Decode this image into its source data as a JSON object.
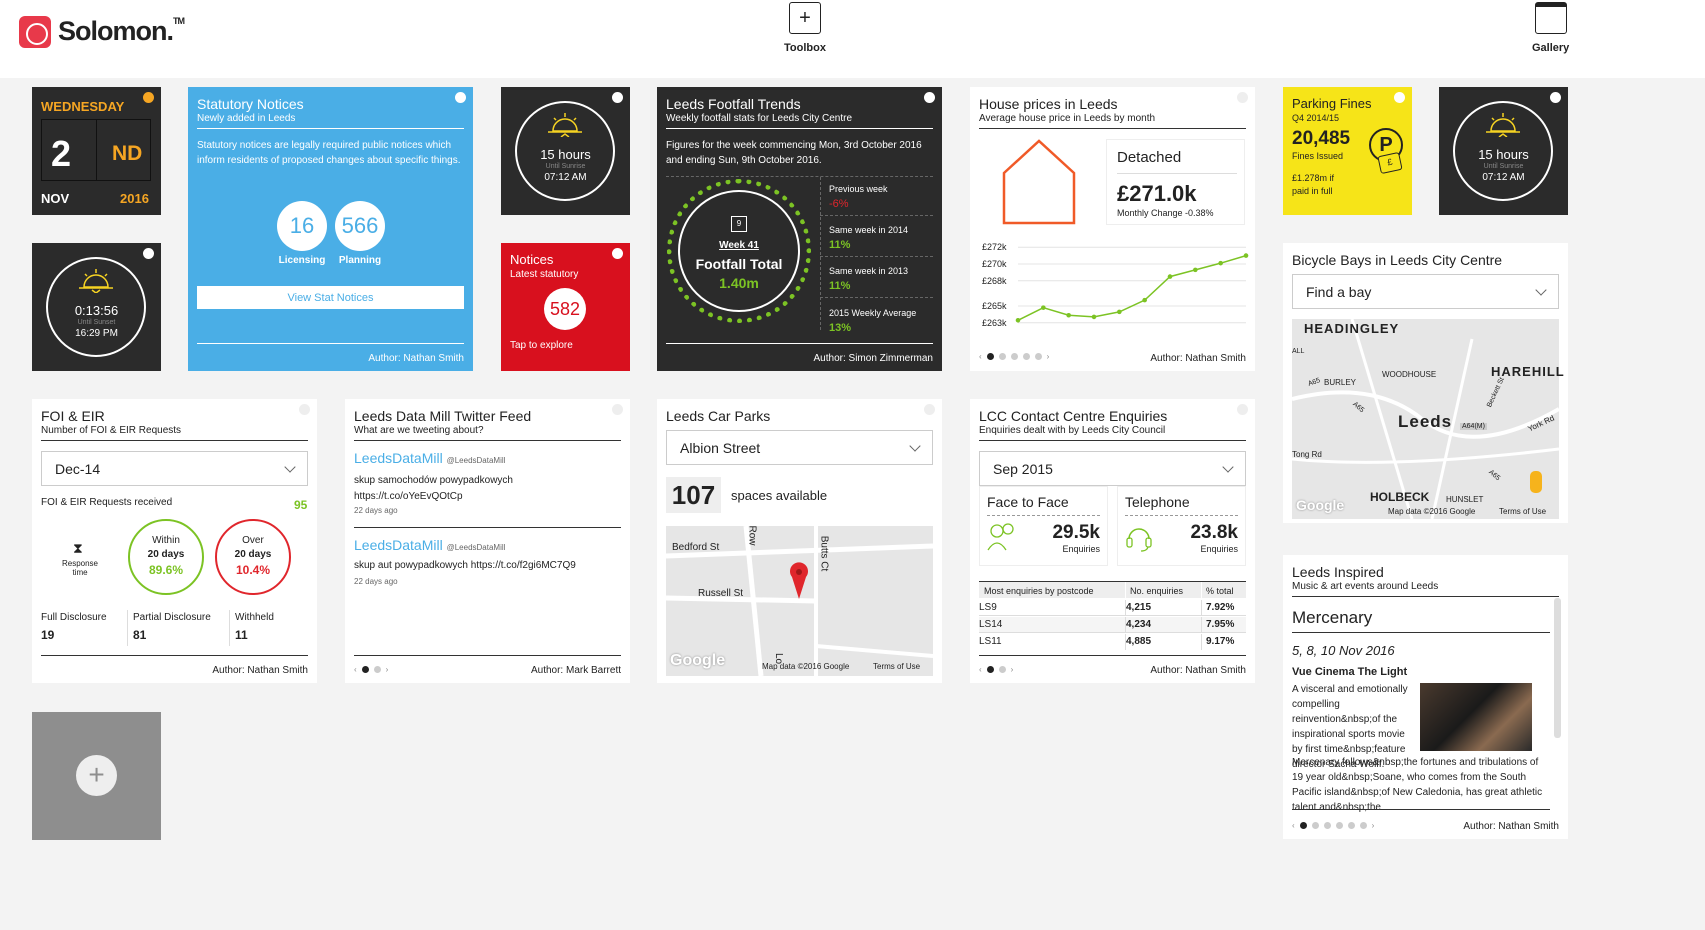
{
  "header": {
    "brand": "Solomon.",
    "tm": "TM",
    "toolbox": "Toolbox",
    "gallery": "Gallery"
  },
  "date": {
    "day": "WEDNESDAY",
    "num": "2",
    "suffix": "ND",
    "month": "NOV",
    "year": "2016"
  },
  "sun1": {
    "time": "15 hours",
    "label": "Until Sunrise",
    "clock": "07:12 AM"
  },
  "sun2": {
    "time": "0:13:56",
    "label": "Until Sunset",
    "clock": "16:29 PM"
  },
  "sun3": {
    "time": "15 hours",
    "label": "Until Sunrise",
    "clock": "07:12 AM"
  },
  "stat": {
    "title": "Statutory Notices",
    "sub": "Newly added in Leeds",
    "desc": "Statutory notices are legally required public notices which inform residents of proposed changes about specific things.",
    "n1": "16",
    "l1": "Licensing",
    "n2": "566",
    "l2": "Planning",
    "button": "View Stat Notices",
    "author": "Author: Nathan Smith"
  },
  "notices": {
    "title": "Notices",
    "sub": "Latest statutory",
    "num": "582",
    "cta": "Tap to explore"
  },
  "footfall": {
    "title": "Leeds Footfall Trends",
    "sub": "Weekly footfall stats for Leeds City Centre",
    "desc": "Figures for the week commencing Mon, 3rd October 2016 and ending Sun, 9th October 2016.",
    "week": "Week 41",
    "label": "Footfall Total",
    "value": "1.40m",
    "s1l": "Previous week",
    "s1v": "-6%",
    "s2l": "Same week in 2014",
    "s2v": "11%",
    "s3l": "Same week in 2013",
    "s3v": "11%",
    "s4l": "2015 Weekly Average",
    "s4v": "13%",
    "author": "Author: Simon Zimmerman",
    "calendar_num": "9"
  },
  "house": {
    "title": "House prices in Leeds",
    "sub": "Average house price in Leeds by month",
    "type": "Detached",
    "price": "£271.0k",
    "change": "Monthly Change -0.38%",
    "author": "Author: Nathan Smith",
    "yticks": [
      "£272k",
      "£270k",
      "£268k",
      "£265k",
      "£263k"
    ]
  },
  "chart_data": {
    "type": "line",
    "x": [
      1,
      2,
      3,
      4,
      5,
      6,
      7,
      8,
      9,
      10
    ],
    "values": [
      263.3,
      264.8,
      263.9,
      263.7,
      264.3,
      265.7,
      268.5,
      269.3,
      270.1,
      271.0
    ],
    "ylim": [
      262.5,
      272.5
    ],
    "yticks": [
      "£272k",
      "£270k",
      "£268k",
      "£265k",
      "£263k"
    ],
    "color": "#7cc324"
  },
  "parking": {
    "title": "Parking Fines",
    "sub": "Q4 2014/15",
    "num": "20,485",
    "label": "Fines Issued",
    "paid": "£1.278m if paid in full",
    "p": "P",
    "pound": "£"
  },
  "bikes": {
    "title": "Bicycle Bays in Leeds City Centre",
    "select": "Find a bay",
    "m1": "HEADINGLEY",
    "m2": "HAREHILL",
    "m3": "Leeds",
    "m4": "HOLBECK",
    "m5": "BURLEY",
    "m6": "WOODHOUSE",
    "m7": "HUNSLET",
    "m8": "Tong Rd",
    "m9": "York Rd",
    "m10": "Map data ©2016 Google",
    "m11": "Terms of Use",
    "m12": "Google",
    "m13": "A65",
    "m14": "A64(M)",
    "m15": "A65",
    "m16": "ALL",
    "m17": "Beckett St",
    "m18": "A65"
  },
  "foi": {
    "title": "FOI & EIR",
    "sub": "Number of FOI & EIR Requests",
    "select": "Dec-14",
    "rec": "FOI & EIR Requests received",
    "total": "95",
    "rt": "Response time",
    "w_l": "Within",
    "w_d": "20 days",
    "w_v": "89.6%",
    "o_l": "Over",
    "o_d": "20 days",
    "o_v": "10.4%",
    "f1l": "Full Disclosure",
    "f1v": "19",
    "f2l": "Partial Disclosure",
    "f2v": "81",
    "f3l": "Withheld",
    "f3v": "11",
    "author": "Author: Nathan Smith"
  },
  "twitter": {
    "title": "Leeds Data Mill Twitter Feed",
    "sub": "What are we tweeting about?",
    "h1": "LeedsDataMill",
    "u1": "@LeedsDataMill",
    "t1": "skup samochodów powypadkowych https://t.co/oYeEvQOtCp",
    "d1": "22 days ago",
    "h2": "LeedsDataMill",
    "u2": "@LeedsDataMill",
    "t2": "skup aut powypadkowych https://t.co/f2gi6MC7Q9",
    "d2": "22 days ago",
    "author": "Author: Mark Barrett"
  },
  "carparks": {
    "title": "Leeds Car Parks",
    "select": "Albion Street",
    "num": "107",
    "label": "spaces available",
    "s1": "Bedford St",
    "s2": "Russell St",
    "s3": "Butts Ct",
    "s4": "Row",
    "s5": "Lo",
    "g": "Google",
    "md": "Map data ©2016 Google",
    "tu": "Terms of Use"
  },
  "contact": {
    "title": "LCC Contact Centre Enquiries",
    "sub": "Enquiries dealt with by Leeds City Council",
    "select": "Sep 2015",
    "f2f": "Face to Face",
    "f2fv": "29.5k",
    "tel": "Telephone",
    "telv": "23.8k",
    "enq": "Enquiries",
    "h1": "Most enquiries by postcode",
    "h2": "No. enquiries",
    "h3": "% total",
    "rows": [
      [
        "LS9",
        "4,215",
        "7.92%"
      ],
      [
        "LS14",
        "4,234",
        "7.95%"
      ],
      [
        "LS11",
        "4,885",
        "9.17%"
      ]
    ],
    "author": "Author: Nathan Smith"
  },
  "inspired": {
    "title": "Leeds Inspired",
    "sub": "Music & art events around Leeds",
    "event": "Mercenary",
    "dates": "5, 8, 10 Nov 2016",
    "venue": "Vue Cinema The Light",
    "desc1": "A visceral and emotionally compelling reinvention&nbsp;of the inspirational sports movie by first time&nbsp;feature director Sacha Wolff.",
    "desc2": "Mercenary follows&nbsp;the fortunes and tribulations of 19 year old&nbsp;Soane, who comes from the South Pacific island&nbsp;of New Caledonia, has great athletic talent and&nbsp;the",
    "author": "Author: Nathan Smith"
  },
  "add": {
    "plus": "+"
  }
}
